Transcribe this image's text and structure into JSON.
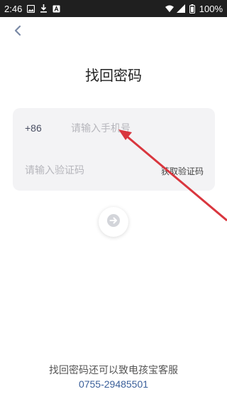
{
  "status_bar": {
    "time": "2:46",
    "battery": "100%",
    "icons": [
      "image-icon",
      "download-icon",
      "app-a-icon",
      "wifi-icon",
      "signal-icon",
      "battery-icon"
    ]
  },
  "header": {
    "back_icon": "chevron-left-icon",
    "title": "找回密码"
  },
  "form": {
    "country_code": "+86",
    "phone_placeholder": "请输入手机号",
    "phone_value": "",
    "code_placeholder": "请输入验证码",
    "code_value": "",
    "get_code_label": "获取验证码"
  },
  "next_button": {
    "icon": "arrow-right-icon"
  },
  "footer": {
    "text": "找回密码还可以致电孩宝客服",
    "phone": "0755-29485501"
  },
  "colors": {
    "accent": "#3a5f9a",
    "annotation_arrow": "#d9363e",
    "card_bg": "#f3f3f5"
  }
}
